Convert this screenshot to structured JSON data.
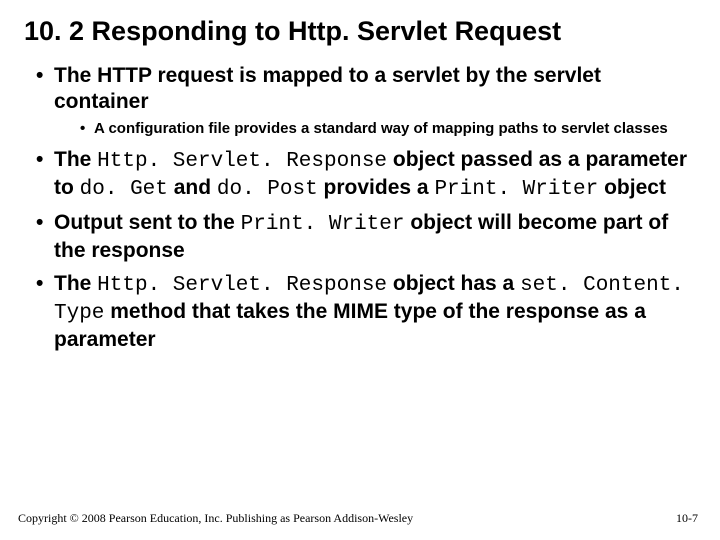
{
  "title": "10. 2 Responding to Http. Servlet Request",
  "bullets": [
    {
      "parts": [
        {
          "t": "The HTTP request is mapped to a servlet by the servlet container"
        }
      ],
      "sub": [
        {
          "parts": [
            {
              "t": "A configuration file provides a standard way of mapping paths to servlet classes"
            }
          ]
        }
      ]
    },
    {
      "parts": [
        {
          "t": "The "
        },
        {
          "t": "Http. Servlet. Response",
          "code": true
        },
        {
          "t": " object passed as a parameter to "
        },
        {
          "t": "do. Get",
          "code": true
        },
        {
          "t": " and "
        },
        {
          "t": "do. Post",
          "code": true
        },
        {
          "t": " provides a "
        },
        {
          "t": "Print. Writer",
          "code": true
        },
        {
          "t": " object"
        }
      ]
    },
    {
      "parts": [
        {
          "t": "Output sent to the "
        },
        {
          "t": "Print. Writer",
          "code": true
        },
        {
          "t": " object will become part of the response"
        }
      ]
    },
    {
      "parts": [
        {
          "t": "The "
        },
        {
          "t": "Http. Servlet. Response",
          "code": true
        },
        {
          "t": " object has a "
        },
        {
          "t": "set. Content. Type",
          "code": true
        },
        {
          "t": " method that takes the MIME type of the response as a parameter"
        }
      ]
    }
  ],
  "footer": "Copyright © 2008 Pearson Education, Inc. Publishing as Pearson Addison-Wesley",
  "pagenum": "10-7"
}
